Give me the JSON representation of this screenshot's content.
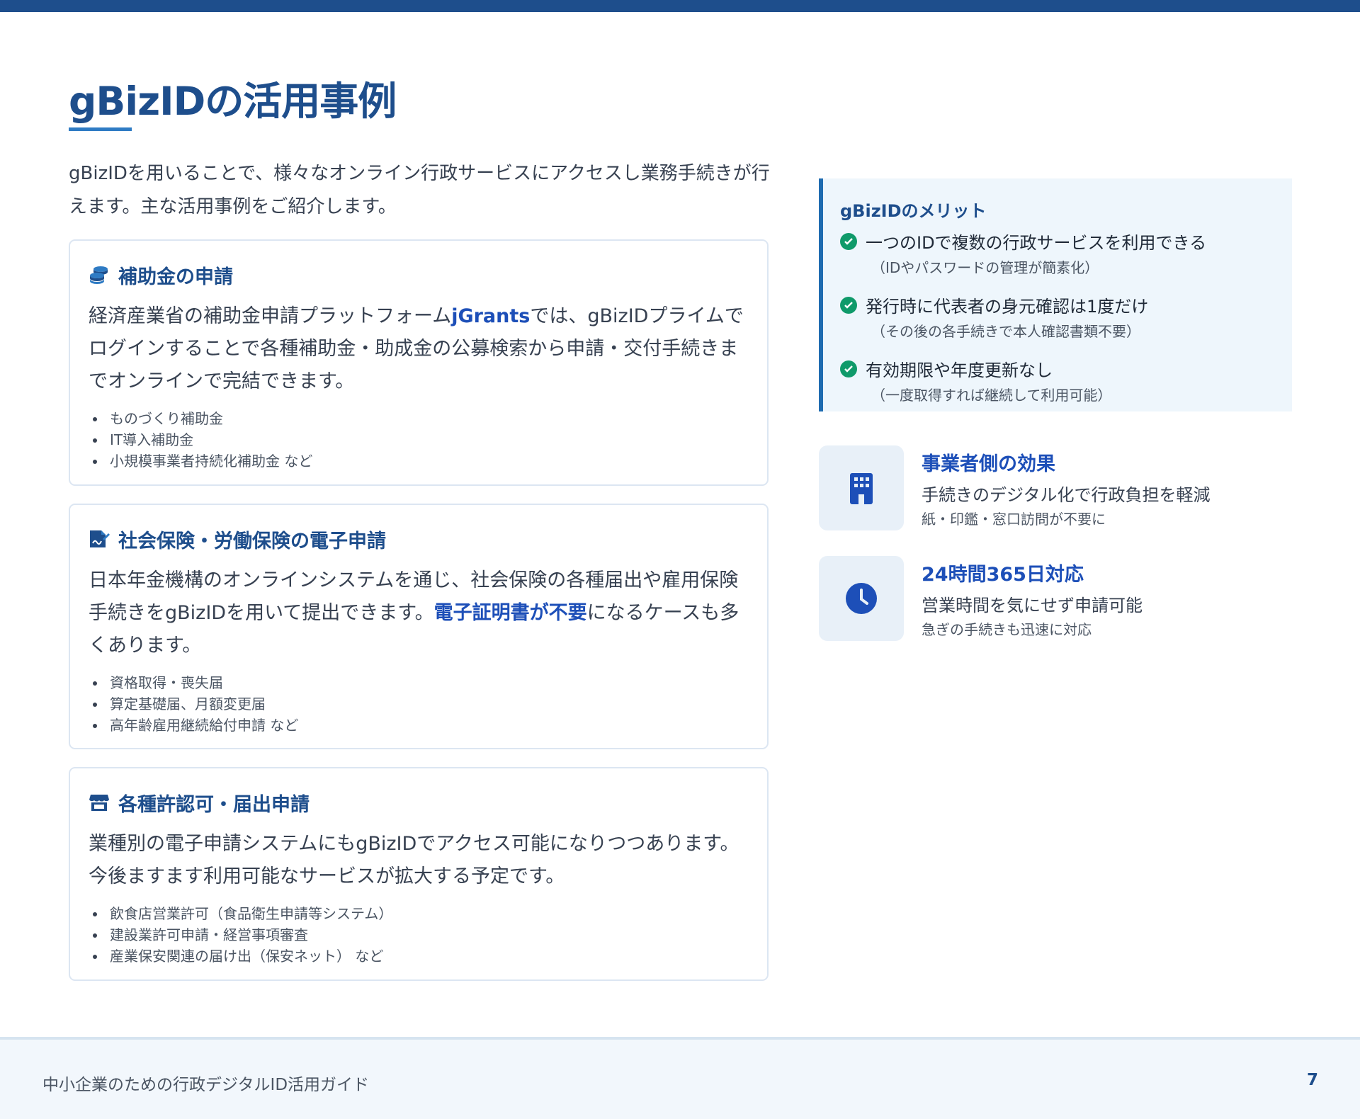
{
  "page": {
    "title": "gBizIDの活用事例",
    "intro": "gBizIDを用いることで、様々なオンライン行政サービスにアクセスし業務手続きが行えます。主な活用事例をご紹介します。"
  },
  "cards": [
    {
      "icon": "coins-icon",
      "title": "補助金の申請",
      "desc_pre": "経済産業省の補助金申請プラットフォーム",
      "desc_highlight": "jGrants",
      "desc_post": "では、gBizIDプライムでログインすることで各種補助金・助成金の公募検索から申請・交付手続きまでオンラインで完結できます。",
      "items": [
        "ものづくり補助金",
        "IT導入補助金",
        "小規模事業者持続化補助金 など"
      ]
    },
    {
      "icon": "signed-document-icon",
      "title": "社会保険・労働保険の電子申請",
      "desc_pre": "日本年金機構のオンラインシステムを通じ、社会保険の各種届出や雇用保険手続きをgBizIDを用いて提出できます。",
      "desc_highlight": "電子証明書が不要",
      "desc_post": "になるケースも多くあります。",
      "items": [
        "資格取得・喪失届",
        "算定基礎届、月額変更届",
        "高年齢雇用継続給付申請 など"
      ]
    },
    {
      "icon": "store-icon",
      "title": "各種許認可・届出申請",
      "desc_pre": "業種別の電子申請システムにもgBizIDでアクセス可能になりつつあります。今後ますます利用可能なサービスが拡大する予定です。",
      "desc_highlight": "",
      "desc_post": "",
      "items": [
        "飲食店営業許可（食品衛生申請等システム）",
        "建設業許可申請・経営事項審査",
        "産業保安関連の届け出（保安ネット） など"
      ]
    }
  ],
  "merit": {
    "title": "gBizIDのメリット",
    "items": [
      {
        "main": "一つのIDで複数の行政サービスを利用できる",
        "sub": "（IDやパスワードの管理が簡素化）"
      },
      {
        "main": "発行時に代表者の身元確認は1度だけ",
        "sub": "（その後の各手続きで本人確認書類不要）"
      },
      {
        "main": "有効期限や年度更新なし",
        "sub": "（一度取得すれば継続して利用可能）"
      }
    ]
  },
  "features": [
    {
      "icon": "building-icon",
      "title": "事業者側の効果",
      "main": "手続きのデジタル化で行政負担を軽減",
      "sub": "紙・印鑑・窓口訪問が不要に"
    },
    {
      "icon": "clock-icon",
      "title": "24時間365日対応",
      "main": "営業時間を気にせず申請可能",
      "sub": "急ぎの手続きも迅速に対応"
    }
  ],
  "footer": {
    "text": "中小企業のための行政デジタルID活用ガイド",
    "page_number": "7"
  },
  "colors": {
    "brand": "#1e4e8c",
    "accent": "#1d4fb8",
    "check": "#0f9a6a",
    "merit_bg": "#eef6fc"
  }
}
